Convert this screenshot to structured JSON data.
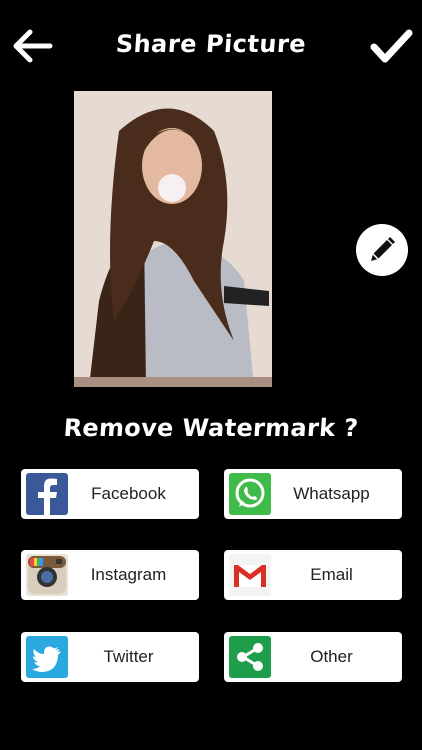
{
  "header": {
    "title": "Share Picture",
    "back_icon": "arrow-left-icon",
    "confirm_icon": "checkmark-icon"
  },
  "photo": {
    "description_icon": "photo-preview"
  },
  "edit": {
    "icon": "pencil-icon"
  },
  "watermark_prompt": "Remove Watermark ?",
  "share_options": [
    {
      "label": "Facebook",
      "icon": "facebook-icon",
      "color": "#3b5998"
    },
    {
      "label": "Whatsapp",
      "icon": "whatsapp-icon",
      "color": "#25a244"
    },
    {
      "label": "Instagram",
      "icon": "instagram-icon",
      "color": "#8a5a3b"
    },
    {
      "label": "Email",
      "icon": "gmail-icon",
      "color": "#d93025"
    },
    {
      "label": "Twitter",
      "icon": "twitter-icon",
      "color": "#2aa9e0"
    },
    {
      "label": "Other",
      "icon": "share-icon",
      "color": "#1e9e4a"
    }
  ]
}
